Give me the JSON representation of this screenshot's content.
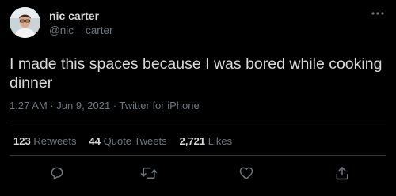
{
  "tweet": {
    "author": {
      "name": "nic carter",
      "handle": "@nic__carter",
      "avatar_icon": "user-avatar"
    },
    "text": "I made this spaces because I was bored while cooking dinner",
    "time": "1:27 AM",
    "separator": " · ",
    "date": "Jun 9, 2021",
    "source": "Twitter for iPhone",
    "stats": {
      "retweets_count": "123",
      "retweets_label": "Retweets",
      "quote_tweets_count": "44",
      "quote_tweets_label": "Quote Tweets",
      "likes_count": "2,721",
      "likes_label": "Likes"
    },
    "action_icons": [
      "reply-icon",
      "retweet-icon",
      "like-icon",
      "share-icon"
    ],
    "more_icon": "more-options-icon"
  },
  "colors": {
    "background": "#000000",
    "text_primary": "#d9d9d9",
    "text_secondary": "#6e767d",
    "divider": "#2f3336",
    "icon": "#6e767d"
  }
}
